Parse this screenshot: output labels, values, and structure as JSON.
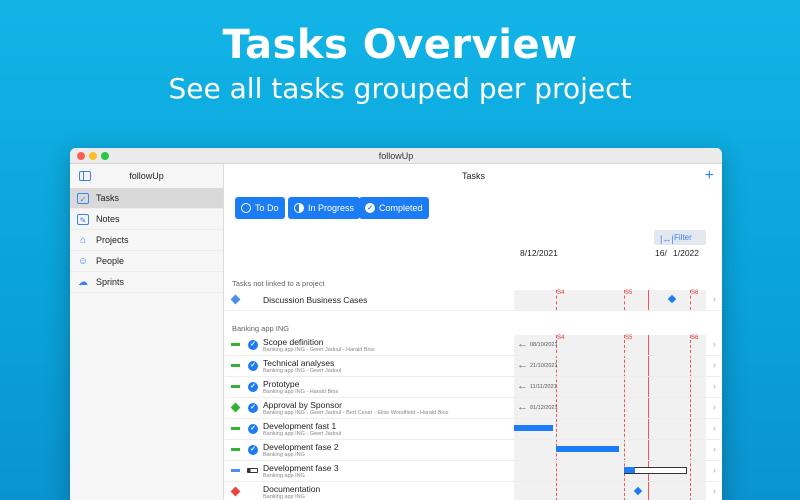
{
  "hero": {
    "title": "Tasks Overview",
    "subtitle": "See all tasks grouped per project"
  },
  "window": {
    "title": "followUp"
  },
  "sidebar": {
    "title": "followUp",
    "items": [
      {
        "label": "Tasks",
        "icon": "checkbox-icon",
        "active": true
      },
      {
        "label": "Notes",
        "icon": "note-icon"
      },
      {
        "label": "Projects",
        "icon": "tray-icon"
      },
      {
        "label": "People",
        "icon": "person-icon"
      },
      {
        "label": "Sprints",
        "icon": "sprint-icon"
      }
    ]
  },
  "main": {
    "title": "Tasks",
    "add_label": "+",
    "statuses": [
      "To Do",
      "In Progress",
      "Completed"
    ],
    "filter_label": "Filter",
    "dates": [
      "8/12/2021",
      "16/",
      "1/2022"
    ],
    "sprint_labels": [
      "S4",
      "S5",
      "S6"
    ]
  },
  "groups": [
    {
      "label": "Tasks not linked to a project",
      "tasks": [
        {
          "title": "Discussion Business Cases"
        }
      ]
    },
    {
      "label": "Banking app ING",
      "tasks": [
        {
          "title": "Scope definition",
          "sub": "Banking app ING - Geert Jadoul - Harald Bios",
          "date": "08/10/2021"
        },
        {
          "title": "Technical analyses",
          "sub": "Banking app ING - Geert Jadoul",
          "date": "21/10/2021"
        },
        {
          "title": "Prototype",
          "sub": "Banking app ING - Harald Bios",
          "date": "11/11/2021"
        },
        {
          "title": "Approval by Sponsor",
          "sub": "Banking app ING - Geert Jadoul - Bert Cesar - Elise Woodfield - Harald Bios",
          "date": "01/12/2021"
        },
        {
          "title": "Development fast 1",
          "sub": "Banking app ING - Geert Jadoul"
        },
        {
          "title": "Development fase 2",
          "sub": "Banking app ING"
        },
        {
          "title": "Development fase 3",
          "sub": "Banking app ING",
          "progress": 0.25
        },
        {
          "title": "Documentation",
          "sub": "Banking app ING"
        }
      ]
    }
  ],
  "colors": {
    "accent": "#1b7cf6",
    "sprint_line": "#e55555",
    "priority_green": "#34b233",
    "milestone_blue": "#4a8ef0",
    "milestone_red": "#e84545"
  }
}
